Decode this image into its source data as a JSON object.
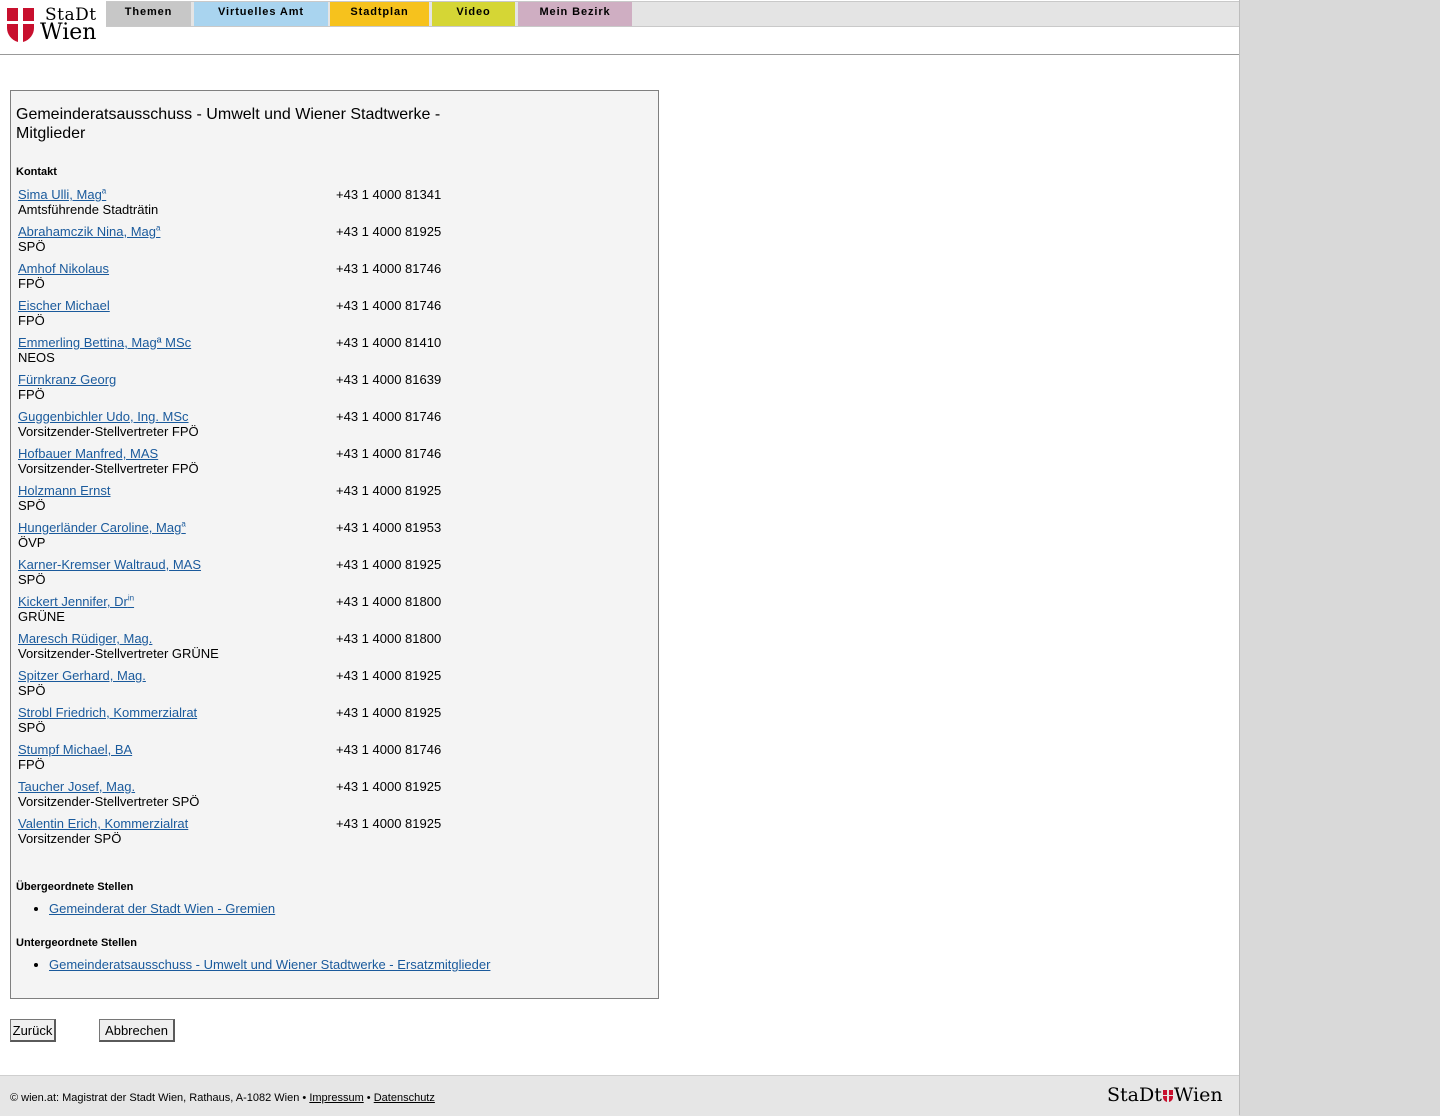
{
  "logo": {
    "line1": "StaDt",
    "line2": "Wien"
  },
  "nav": {
    "tabs": [
      {
        "label": "Themen"
      },
      {
        "label": "Virtuelles Amt"
      },
      {
        "label": "Stadtplan"
      },
      {
        "label": "Video"
      },
      {
        "label": "Mein Bezirk"
      }
    ]
  },
  "panel": {
    "title": "Gemeinderatsausschuss - Umwelt und Wiener Stadtwerke - Mitglieder",
    "contact_label": "Kontakt",
    "members": [
      {
        "name": "Sima Ulli, Mag",
        "suffix": "a",
        "role": "Amtsführende Stadträtin",
        "phone": "+43 1 4000 81341"
      },
      {
        "name": "Abrahamczik Nina, Mag",
        "suffix": "a",
        "role": "SPÖ",
        "phone": "+43 1 4000 81925"
      },
      {
        "name": "Amhof Nikolaus",
        "suffix": "",
        "role": "FPÖ",
        "phone": "+43 1 4000 81746"
      },
      {
        "name": "Eischer Michael",
        "suffix": "",
        "role": "FPÖ",
        "phone": "+43 1 4000 81746"
      },
      {
        "name": "Emmerling Bettina, Magª MSc",
        "suffix": "",
        "role": "NEOS",
        "phone": "+43 1 4000 81410"
      },
      {
        "name": "Fürnkranz Georg",
        "suffix": "",
        "role": "FPÖ",
        "phone": "+43 1 4000 81639"
      },
      {
        "name": "Guggenbichler Udo, Ing. MSc",
        "suffix": "",
        "role": "Vorsitzender-Stellvertreter FPÖ",
        "phone": "+43 1 4000 81746"
      },
      {
        "name": "Hofbauer Manfred, MAS",
        "suffix": "",
        "role": "Vorsitzender-Stellvertreter FPÖ",
        "phone": "+43 1 4000 81746"
      },
      {
        "name": "Holzmann Ernst",
        "suffix": "",
        "role": "SPÖ",
        "phone": "+43 1 4000 81925"
      },
      {
        "name": "Hungerländer Caroline, Mag",
        "suffix": "a",
        "role": "ÖVP",
        "phone": "+43 1 4000 81953"
      },
      {
        "name": "Karner-Kremser Waltraud, MAS",
        "suffix": "",
        "role": "SPÖ",
        "phone": "+43 1 4000 81925"
      },
      {
        "name": "Kickert Jennifer, Dr",
        "suffix": "in",
        "role": "GRÜNE",
        "phone": "+43 1 4000 81800"
      },
      {
        "name": "Maresch Rüdiger, Mag.",
        "suffix": "",
        "role": "Vorsitzender-Stellvertreter GRÜNE",
        "phone": "+43 1 4000 81800"
      },
      {
        "name": "Spitzer Gerhard, Mag.",
        "suffix": "",
        "role": "SPÖ",
        "phone": "+43 1 4000 81925"
      },
      {
        "name": "Strobl Friedrich, Kommerzialrat",
        "suffix": "",
        "role": "SPÖ",
        "phone": "+43 1 4000 81925"
      },
      {
        "name": "Stumpf Michael, BA",
        "suffix": "",
        "role": "FPÖ",
        "phone": "+43 1 4000 81746"
      },
      {
        "name": "Taucher Josef, Mag.",
        "suffix": "",
        "role": "Vorsitzender-Stellvertreter SPÖ",
        "phone": "+43 1 4000 81925"
      },
      {
        "name": "Valentin Erich, Kommerzialrat",
        "suffix": "",
        "role": "Vorsitzender SPÖ",
        "phone": "+43 1 4000 81925"
      }
    ],
    "parent_label": "Übergeordnete Stellen",
    "parent_links": [
      "Gemeinderat der Stadt Wien - Gremien"
    ],
    "child_label": "Untergeordnete Stellen",
    "child_links": [
      "Gemeinderatsausschuss - Umwelt und Wiener Stadtwerke - Ersatzmitglieder"
    ]
  },
  "buttons": {
    "back": "Zurück",
    "cancel": "Abbrechen"
  },
  "footer": {
    "copyright": "© wien.at: Magistrat der Stadt Wien, Rathaus, A-1082 Wien •",
    "impressum": "Impressum",
    "separator": "•",
    "datenschutz": "Datenschutz",
    "logo_left": "StaDt",
    "logo_right": "Wien"
  },
  "colors": {
    "link": "#1a5a9c",
    "brand_red": "#c8102e",
    "panel_bg": "#f4f4f4"
  }
}
